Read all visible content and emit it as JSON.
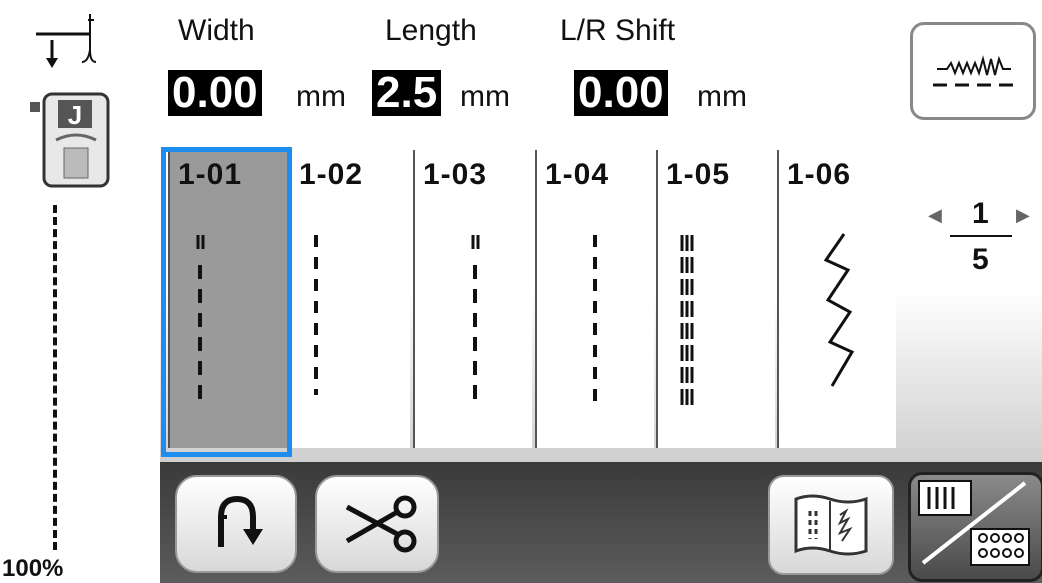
{
  "header": {
    "width_label": "Width",
    "width_value": "0.00",
    "length_label": "Length",
    "length_value": "2.5",
    "shift_label": "L/R Shift",
    "shift_value": "0.00",
    "unit": "mm"
  },
  "sidebar": {
    "presser_foot": "J",
    "zoom": "100%"
  },
  "stitches": [
    {
      "label": "1-01",
      "selected": true
    },
    {
      "label": "1-02",
      "selected": false
    },
    {
      "label": "1-03",
      "selected": false
    },
    {
      "label": "1-04",
      "selected": false
    },
    {
      "label": "1-05",
      "selected": false
    },
    {
      "label": "1-06",
      "selected": false
    }
  ],
  "pager": {
    "current": "1",
    "total": "5"
  },
  "colors": {
    "selection": "#1f8cf0",
    "selected_cell": "#9a9a9a"
  },
  "icons": {
    "needle": "needle-position-icon",
    "foot": "presser-foot-icon",
    "preview": "stitch-preview-icon",
    "reverse": "reverse-stitch-icon",
    "cut": "scissors-icon",
    "manual": "manual-book-icon",
    "switch": "category-switch-icon"
  }
}
